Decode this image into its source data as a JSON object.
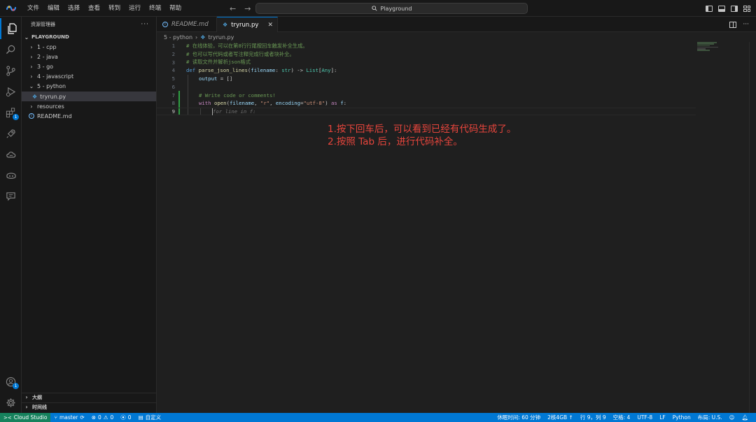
{
  "menu": [
    "文件",
    "编辑",
    "选择",
    "查看",
    "转到",
    "运行",
    "终端",
    "帮助"
  ],
  "search": {
    "label": "Playground"
  },
  "sidebar": {
    "title": "资源管理器",
    "section": "PLAYGROUND",
    "items": [
      {
        "label": "1 - cpp",
        "type": "folder",
        "expanded": false
      },
      {
        "label": "2 - java",
        "type": "folder",
        "expanded": false
      },
      {
        "label": "3 - go",
        "type": "folder",
        "expanded": false
      },
      {
        "label": "4 - javascript",
        "type": "folder",
        "expanded": false
      },
      {
        "label": "5 - python",
        "type": "folder",
        "expanded": true
      },
      {
        "label": "tryrun.py",
        "type": "python-file",
        "selected": true
      },
      {
        "label": "resources",
        "type": "folder",
        "expanded": false
      },
      {
        "label": "README.md",
        "type": "info-file"
      }
    ],
    "outline": "大纲",
    "timeline": "时间线"
  },
  "tabs": [
    {
      "label": "README.md",
      "active": false
    },
    {
      "label": "tryrun.py",
      "active": true
    }
  ],
  "breadcrumb": {
    "folder": "5 - python",
    "file": "tryrun.py"
  },
  "code": {
    "line_numbers": [
      "1",
      "2",
      "3",
      "4",
      "5",
      "6",
      "7",
      "8",
      "9"
    ],
    "l1": "# 在线体验，可以在第8行行尾按回车触发补全生成。",
    "l2": "# 也可以写代码或者写注释完成行或者块补全。",
    "l3": "# 读取文件并解析json格式",
    "l4": {
      "def": "def",
      "fn": "parse_json_lines",
      "p1": "(",
      "param": "filename",
      "p2": ": ",
      "type1": "str",
      "p3": ") -> ",
      "type2": "List",
      "p4": "[",
      "type3": "Any",
      "p5": "]:"
    },
    "l5": {
      "var": "output",
      "rest": " = []"
    },
    "l7": "# Write code or comments!",
    "l8": {
      "with": "with",
      "fn": "open",
      "p1": "(",
      "arg": "filename",
      "p2": ", ",
      "str1": "\"r\"",
      "p3": ", ",
      "kw": "encoding",
      "p4": "=",
      "str2": "\"utf-8\"",
      "p5": ") ",
      "as": "as",
      "var": " f",
      "p6": ":"
    },
    "l9_ghost": "for line in f:"
  },
  "annotation": {
    "line1": "1.按下回车后，可以看到已经有代码生成了。",
    "line2": "2.按照 Tab 后，进行代码补全。"
  },
  "statusbar": {
    "remote": "Cloud Studio",
    "branch": "master",
    "errors": "0",
    "warnings": "0",
    "ports": "0",
    "custom": "自定义",
    "right": [
      "休眠时间: 60 分钟",
      "2核4GB ↑",
      "行 9，列 9",
      "空格: 4",
      "UTF-8",
      "LF",
      "Python",
      "布局: U.S."
    ]
  },
  "colors": {
    "accent": "#0078d4",
    "remote": "#16825d",
    "annotation": "#e8453c"
  },
  "badges": {
    "extensions": "1",
    "accounts": "1"
  }
}
